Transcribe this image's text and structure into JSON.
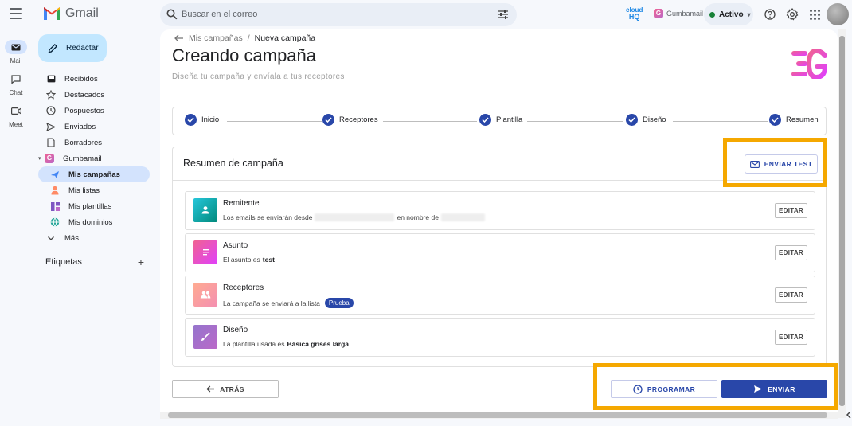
{
  "header": {
    "app_name": "Gmail",
    "search_placeholder": "Buscar en el correo",
    "cloudhq_line1": "cloud",
    "cloudhq_line2": "HQ",
    "addon_name": "Gumbamail",
    "status_label": "Activo"
  },
  "rail": {
    "mail": "Mail",
    "chat": "Chat",
    "meet": "Meet"
  },
  "sidebar": {
    "compose": "Redactar",
    "items": [
      "Recibidos",
      "Destacados",
      "Pospuestos",
      "Enviados",
      "Borradores"
    ],
    "gumbamail": "Gumbamail",
    "sub_items": [
      "Mis campañas",
      "Mis listas",
      "Mis plantillas",
      "Mis dominios"
    ],
    "more": "Más",
    "labels_title": "Etiquetas"
  },
  "main": {
    "breadcrumb_parent": "Mis campañas",
    "breadcrumb_sep": "/",
    "breadcrumb_current": "Nueva campaña",
    "title": "Creando campaña",
    "subtitle": "Diseña tu campaña y envíala a tus receptores",
    "steps": [
      "Inicio",
      "Receptores",
      "Plantilla",
      "Diseño",
      "Resumen"
    ],
    "summary_title": "Resumen de campaña",
    "send_test": "ENVIAR TEST",
    "cards": {
      "sender": {
        "title": "Remitente",
        "desc_a": "Los emails se enviarán desde",
        "desc_b": "en nombre de"
      },
      "subject": {
        "title": "Asunto",
        "desc": "El asunto es",
        "value": "test"
      },
      "recipients": {
        "title": "Receptores",
        "desc": "La campaña se enviará a la lista",
        "chip": "Prueba"
      },
      "design": {
        "title": "Diseño",
        "desc": "La plantilla usada es",
        "value": "Básica grises larga"
      }
    },
    "edit_label": "EDITAR",
    "back": "ATRÁS",
    "schedule": "PROGRAMAR",
    "send": "ENVIAR"
  },
  "colors": {
    "primary": "#2947a9",
    "highlight": "#f5a800",
    "active_nav": "#d3e3fd",
    "compose_bg": "#c2e7ff"
  }
}
